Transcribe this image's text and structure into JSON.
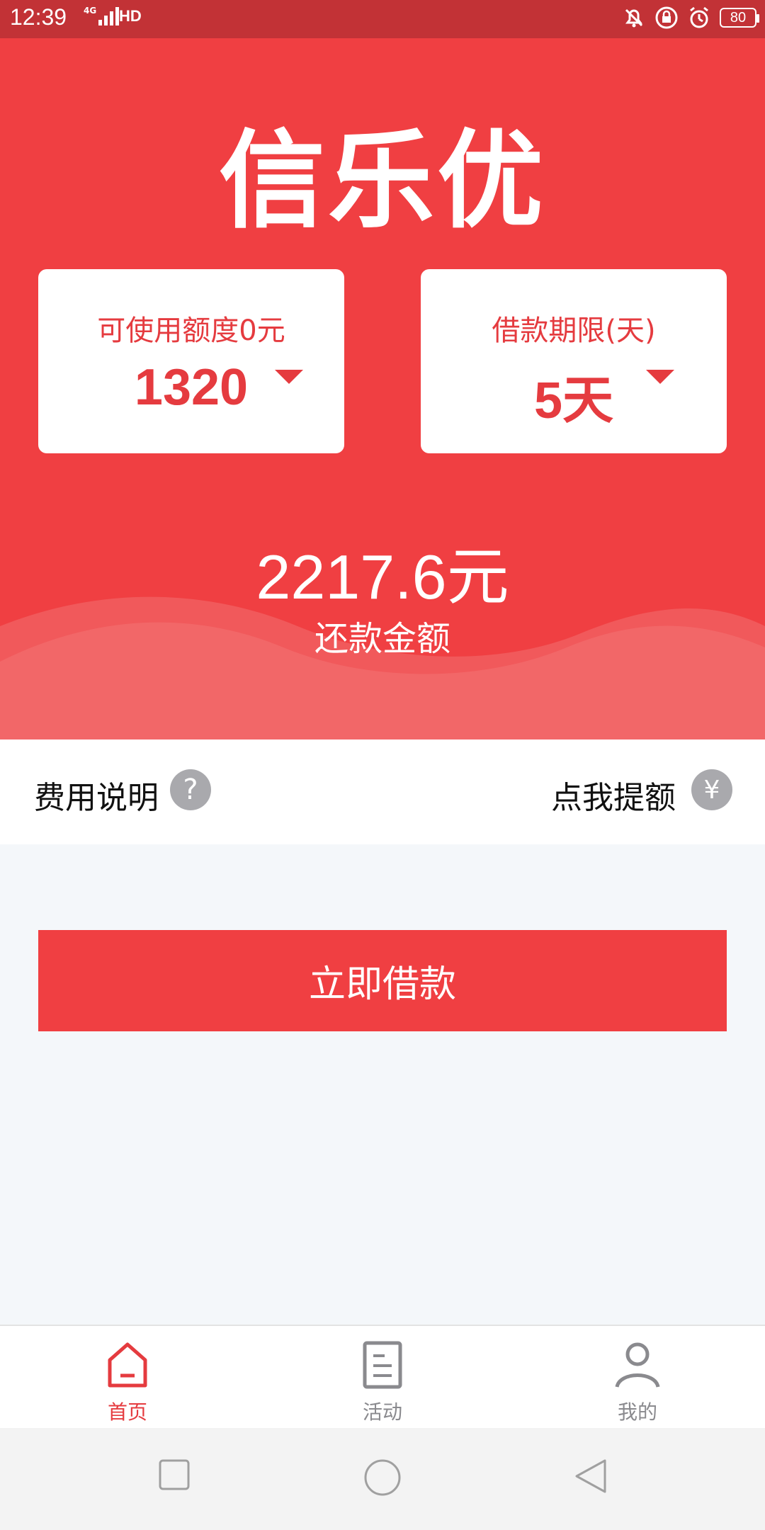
{
  "status_bar": {
    "time": "12:39",
    "network": "4G",
    "hd": "HD",
    "battery": "80"
  },
  "app": {
    "title": "信乐优"
  },
  "cards": {
    "amount": {
      "label": "可使用额度0元",
      "value": "1320"
    },
    "term": {
      "label": "借款期限(天)",
      "value": "5天"
    }
  },
  "repayment": {
    "amount": "2217.6元",
    "label": "还款金额"
  },
  "info_row": {
    "fee_label": "费用说明",
    "fee_help_icon": "?",
    "raise_label": "点我提额",
    "raise_icon": "¥"
  },
  "borrow_button": {
    "label": "立即借款"
  },
  "bottom_nav": {
    "items": [
      {
        "label": "首页",
        "icon": "home-icon",
        "active": true
      },
      {
        "label": "活动",
        "icon": "document-icon",
        "active": false
      },
      {
        "label": "我的",
        "icon": "user-icon",
        "active": false
      }
    ],
    "active_color": "#e53b3f",
    "inactive_color": "#8a8a8e"
  },
  "colors": {
    "brand_red": "#f03f42",
    "status_bar": "#c23236"
  }
}
